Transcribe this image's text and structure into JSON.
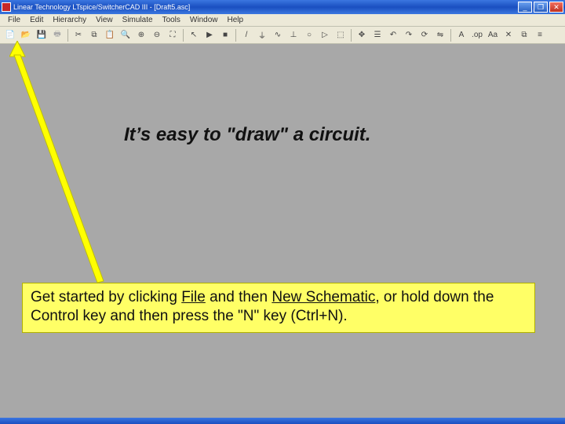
{
  "titlebar": {
    "title": "Linear Technology LTspice/SwitcherCAD III - [Draft5.asc]"
  },
  "window_controls": {
    "minimize": "_",
    "maximize": "❐",
    "close": "✕"
  },
  "menubar": {
    "items": [
      "File",
      "Edit",
      "Hierarchy",
      "View",
      "Simulate",
      "Tools",
      "Window",
      "Help"
    ]
  },
  "toolbar": {
    "icons": [
      {
        "name": "new-schematic-icon",
        "glyph": "📄"
      },
      {
        "name": "open-icon",
        "glyph": "📂"
      },
      {
        "name": "save-icon",
        "glyph": "💾"
      },
      {
        "name": "print-icon",
        "glyph": "🖶",
        "disabled": true
      },
      {
        "name": "cut-icon",
        "glyph": "✂"
      },
      {
        "name": "copy-icon",
        "glyph": "⧉"
      },
      {
        "name": "paste-icon",
        "glyph": "📋"
      },
      {
        "name": "search-icon",
        "glyph": "🔍"
      },
      {
        "name": "zoom-in-icon",
        "glyph": "⊕"
      },
      {
        "name": "zoom-out-icon",
        "glyph": "⊖"
      },
      {
        "name": "zoom-fit-icon",
        "glyph": "⛶"
      },
      {
        "name": "pick-icon",
        "glyph": "↖"
      },
      {
        "name": "run-icon",
        "glyph": "▶"
      },
      {
        "name": "stop-icon",
        "glyph": "■"
      },
      {
        "name": "wire-icon",
        "glyph": "/"
      },
      {
        "name": "ground-icon",
        "glyph": "⏚"
      },
      {
        "name": "resistor-icon",
        "glyph": "∿"
      },
      {
        "name": "capacitor-icon",
        "glyph": "⊥"
      },
      {
        "name": "inductor-icon",
        "glyph": "○"
      },
      {
        "name": "diode-icon",
        "glyph": "▷"
      },
      {
        "name": "component-icon",
        "glyph": "⬚"
      },
      {
        "name": "move-icon",
        "glyph": "✥"
      },
      {
        "name": "drag-icon",
        "glyph": "☰"
      },
      {
        "name": "undo-icon",
        "glyph": "↶"
      },
      {
        "name": "redo-icon",
        "glyph": "↷"
      },
      {
        "name": "rotate-icon",
        "glyph": "⟳"
      },
      {
        "name": "mirror-icon",
        "glyph": "⇋"
      },
      {
        "name": "text-icon",
        "glyph": "A"
      },
      {
        "name": "spice-directive-icon",
        "glyph": ".op"
      },
      {
        "name": "label-icon",
        "glyph": "Aa"
      },
      {
        "name": "delete-icon",
        "glyph": "✕"
      },
      {
        "name": "duplicate-icon",
        "glyph": "⧉"
      },
      {
        "name": "netname-icon",
        "glyph": "≡"
      }
    ]
  },
  "headline": "It’s easy to \"draw\" a circuit.",
  "callout": {
    "prefix": "Get started by clicking ",
    "file": "File",
    "mid1": " and then ",
    "newschematic": "New Schematic",
    "mid2": ", or hold down the Control key and then press the \"N\" key (Ctrl+N)."
  },
  "colors": {
    "arrow": "#ffff00",
    "callout_bg": "#ffff66"
  }
}
